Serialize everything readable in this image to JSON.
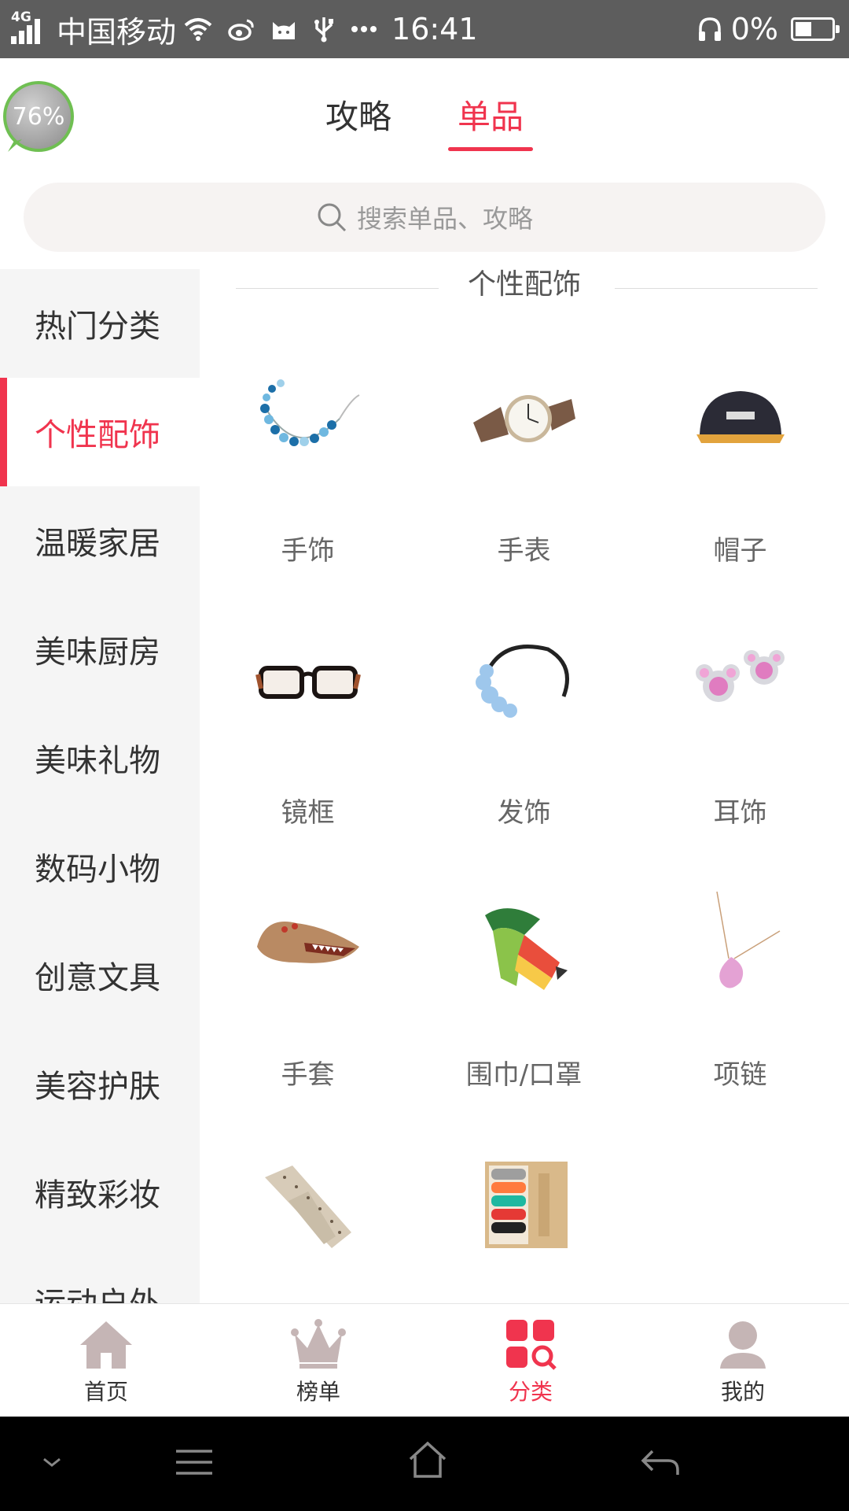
{
  "status_bar": {
    "network": "4G",
    "carrier": "中国移动",
    "time": "16:41",
    "battery_text": "0%",
    "battery_level": 0.25,
    "icons": [
      "signal-icon",
      "wifi-icon",
      "weibo-icon",
      "cat-icon",
      "usb-icon",
      "more-dots-icon",
      "headphone-icon",
      "battery-icon"
    ]
  },
  "floating_badge": {
    "text": "76%"
  },
  "header": {
    "tabs": [
      {
        "label": "攻略",
        "active": false
      },
      {
        "label": "单品",
        "active": true
      }
    ]
  },
  "search": {
    "placeholder": "搜索单品、攻略"
  },
  "sidebar": {
    "items": [
      {
        "label": "热门分类",
        "active": false
      },
      {
        "label": "个性配饰",
        "active": true
      },
      {
        "label": "温暖家居",
        "active": false
      },
      {
        "label": "美味厨房",
        "active": false
      },
      {
        "label": "美味礼物",
        "active": false
      },
      {
        "label": "数码小物",
        "active": false
      },
      {
        "label": "创意文具",
        "active": false
      },
      {
        "label": "美容护肤",
        "active": false
      },
      {
        "label": "精致彩妆",
        "active": false
      },
      {
        "label": "运动户外",
        "active": false
      }
    ]
  },
  "content": {
    "section_title": "个性配饰",
    "items": [
      {
        "label": "手饰",
        "icon": "bracelet-image"
      },
      {
        "label": "手表",
        "icon": "watch-image"
      },
      {
        "label": "帽子",
        "icon": "cap-image"
      },
      {
        "label": "镜框",
        "icon": "glasses-image"
      },
      {
        "label": "发饰",
        "icon": "hairband-image"
      },
      {
        "label": "耳饰",
        "icon": "earring-image"
      },
      {
        "label": "手套",
        "icon": "gloves-image"
      },
      {
        "label": "围巾/口罩",
        "icon": "scarf-image"
      },
      {
        "label": "项链",
        "icon": "necklace-image"
      },
      {
        "label": "",
        "icon": "tie-image"
      },
      {
        "label": "",
        "icon": "socks-box-image"
      }
    ]
  },
  "bottom_nav": {
    "items": [
      {
        "label": "首页",
        "icon": "home-icon",
        "active": false
      },
      {
        "label": "榜单",
        "icon": "crown-icon",
        "active": false
      },
      {
        "label": "分类",
        "icon": "category-icon",
        "active": true
      },
      {
        "label": "我的",
        "icon": "profile-icon",
        "active": false
      }
    ]
  },
  "colors": {
    "accent": "#f0344e",
    "sidebar_bg": "#f5f5f5",
    "nav_icon": "#c5b5b5"
  }
}
